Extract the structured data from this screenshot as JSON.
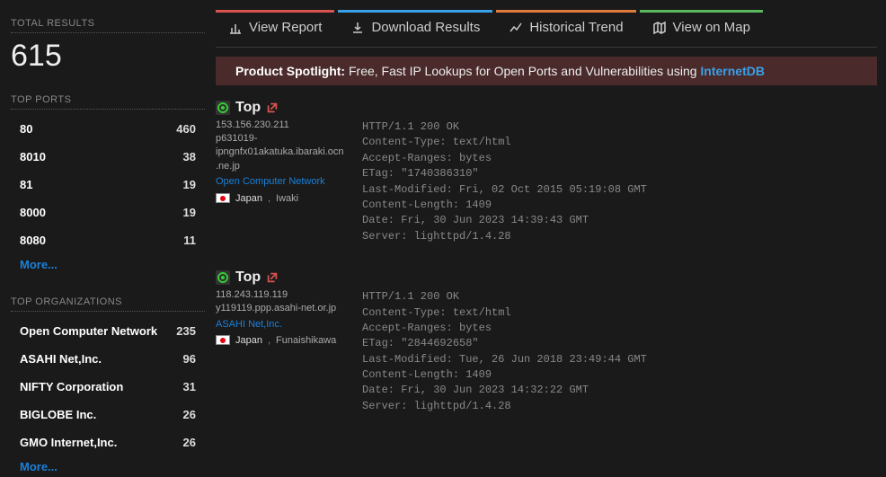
{
  "totals": {
    "label": "TOTAL RESULTS",
    "value": "615"
  },
  "facets": {
    "ports": {
      "title": "TOP PORTS",
      "rows": [
        {
          "label": "80",
          "count": "460"
        },
        {
          "label": "8010",
          "count": "38"
        },
        {
          "label": "81",
          "count": "19"
        },
        {
          "label": "8000",
          "count": "19"
        },
        {
          "label": "8080",
          "count": "11"
        }
      ],
      "more": "More..."
    },
    "orgs": {
      "title": "TOP ORGANIZATIONS",
      "rows": [
        {
          "label": "Open Computer Network",
          "count": "235"
        },
        {
          "label": "ASAHI Net,Inc.",
          "count": "96"
        },
        {
          "label": "NIFTY Corporation",
          "count": "31"
        },
        {
          "label": "BIGLOBE Inc.",
          "count": "26"
        },
        {
          "label": "GMO Internet,Inc.",
          "count": "26"
        }
      ],
      "more": "More..."
    }
  },
  "tabs": [
    {
      "label": "View Report"
    },
    {
      "label": "Download Results"
    },
    {
      "label": "Historical Trend"
    },
    {
      "label": "View on Map"
    }
  ],
  "spotlight": {
    "label": "Product Spotlight:",
    "text": " Free, Fast IP Lookups for Open Ports and Vulnerabilities using ",
    "link": "InternetDB"
  },
  "results": [
    {
      "title": "Top",
      "ip": "153.156.230.211",
      "host": "p631019-ipngnfx01akatuka.ibaraki.ocn.ne.jp",
      "org": "Open Computer Network",
      "country": "Japan",
      "city": "Iwaki",
      "raw": "HTTP/1.1 200 OK\nContent-Type: text/html\nAccept-Ranges: bytes\nETag: \"1740386310\"\nLast-Modified: Fri, 02 Oct 2015 05:19:08 GMT\nContent-Length: 1409\nDate: Fri, 30 Jun 2023 14:39:43 GMT\nServer: lighttpd/1.4.28"
    },
    {
      "title": "Top",
      "ip": "118.243.119.119",
      "host": "y119119.ppp.asahi-net.or.jp",
      "org": "ASAHI Net,Inc.",
      "country": "Japan",
      "city": "Funaishikawa",
      "raw": "HTTP/1.1 200 OK\nContent-Type: text/html\nAccept-Ranges: bytes\nETag: \"2844692658\"\nLast-Modified: Tue, 26 Jun 2018 23:49:44 GMT\nContent-Length: 1409\nDate: Fri, 30 Jun 2023 14:32:22 GMT\nServer: lighttpd/1.4.28"
    }
  ]
}
